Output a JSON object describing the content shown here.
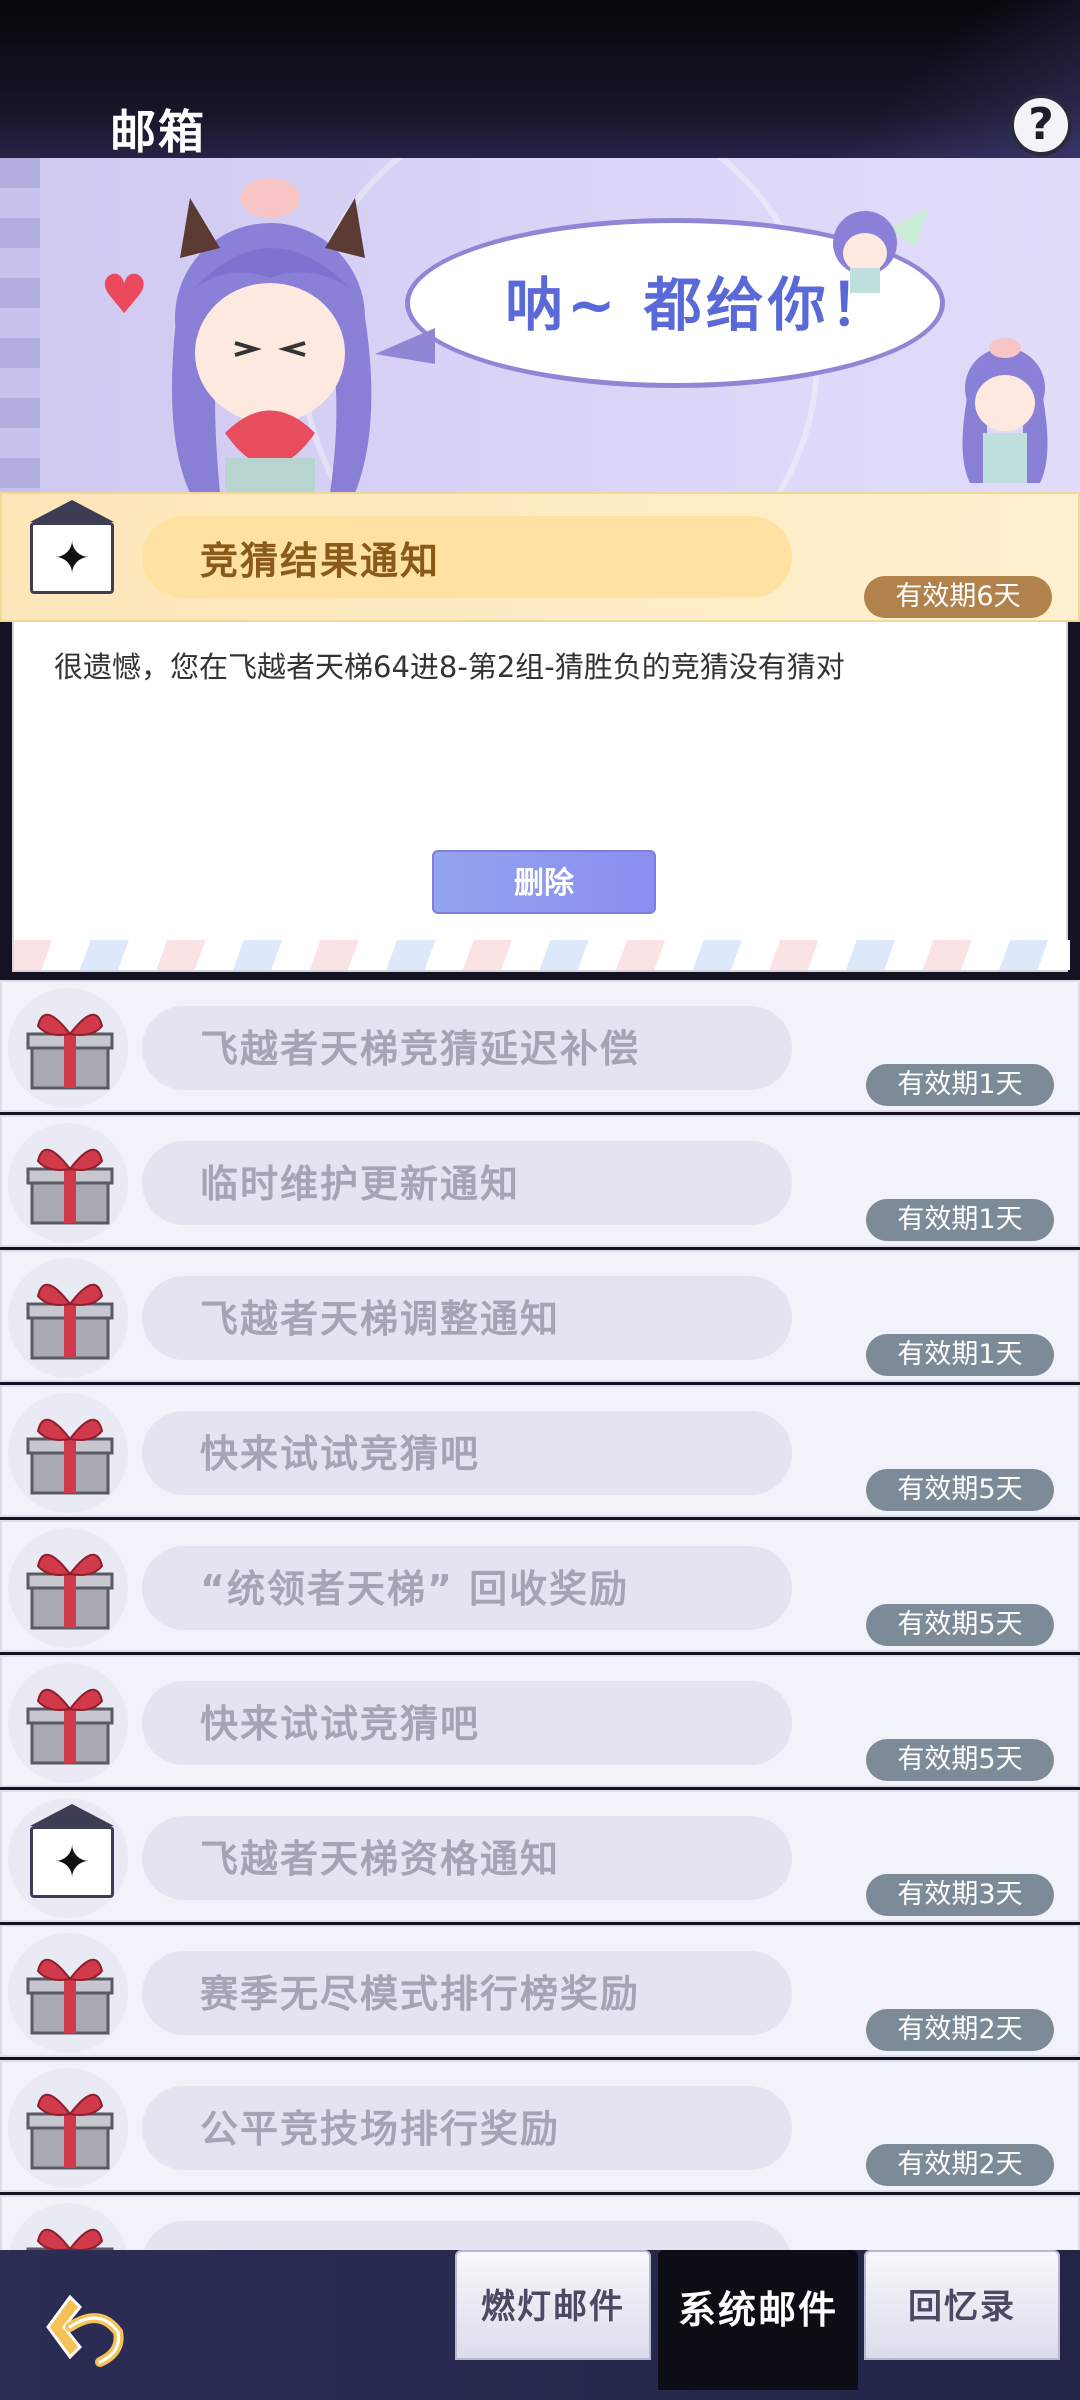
{
  "header": {
    "title": "邮箱",
    "help_glyph": "?"
  },
  "banner": {
    "speech": "呐~ 都给你！"
  },
  "expanded_mail": {
    "subject": "竞猜结果通知",
    "expiry": "有效期6天",
    "body": "很遗憾，您在飞越者天梯64进8-第2组-猜胜负的竞猜没有猜对",
    "delete_label": "删除",
    "icon": "envelope-icon"
  },
  "mails": [
    {
      "subject": "飞越者天梯竞猜延迟补偿",
      "expiry": "有效期1天",
      "icon": "gift-icon"
    },
    {
      "subject": "临时维护更新通知",
      "expiry": "有效期1天",
      "icon": "gift-icon"
    },
    {
      "subject": "飞越者天梯调整通知",
      "expiry": "有效期1天",
      "icon": "gift-icon"
    },
    {
      "subject": "快来试试竞猜吧",
      "expiry": "有效期5天",
      "icon": "gift-icon"
    },
    {
      "subject": "“统领者天梯” 回收奖励",
      "expiry": "有效期5天",
      "icon": "gift-icon"
    },
    {
      "subject": "快来试试竞猜吧",
      "expiry": "有效期5天",
      "icon": "gift-icon"
    },
    {
      "subject": "飞越者天梯资格通知",
      "expiry": "有效期3天",
      "icon": "envelope-icon"
    },
    {
      "subject": "赛季无尽模式排行榜奖励",
      "expiry": "有效期2天",
      "icon": "gift-icon"
    },
    {
      "subject": "公平竞技场排行奖励",
      "expiry": "有效期2天",
      "icon": "gift-icon"
    }
  ],
  "tabs": {
    "lantern": "燃灯邮件",
    "system": "系统邮件",
    "memories": "回忆录"
  },
  "colors": {
    "expiry_active": "#b2824c",
    "expiry_inactive": "#7d8b98",
    "subject_active": "#8a5a1a",
    "subject_inactive": "#a4a4b4"
  }
}
